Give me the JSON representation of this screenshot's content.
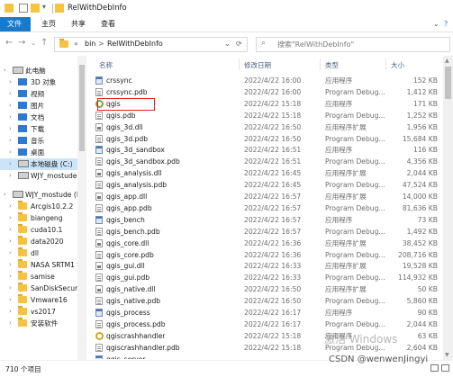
{
  "window": {
    "title": "RelWithDebInfo"
  },
  "ribbon": {
    "tabs": [
      "文件",
      "主页",
      "共享",
      "查看"
    ]
  },
  "address": {
    "breadcrumb": [
      "«",
      "bin",
      ">",
      "RelWithDebInfo"
    ]
  },
  "search": {
    "placeholder": "搜索\"RelWithDebInfo\""
  },
  "nav_pane": {
    "items": [
      {
        "label": "此电脑",
        "icon": "pc-icon",
        "indent": 0
      },
      {
        "label": "3D 对象",
        "icon": "3d-objects-icon",
        "indent": 1
      },
      {
        "label": "视频",
        "icon": "video-icon",
        "indent": 1
      },
      {
        "label": "图片",
        "icon": "pictures-icon",
        "indent": 1
      },
      {
        "label": "文档",
        "icon": "documents-icon",
        "indent": 1
      },
      {
        "label": "下载",
        "icon": "downloads-icon",
        "indent": 1
      },
      {
        "label": "音乐",
        "icon": "music-icon",
        "indent": 1
      },
      {
        "label": "桌面",
        "icon": "desktop-icon",
        "indent": 1
      },
      {
        "label": "本地磁盘 (C:)",
        "icon": "drive-icon",
        "indent": 1,
        "selected": true
      },
      {
        "label": "WJY_mostude (",
        "icon": "drive-icon",
        "indent": 1
      },
      {
        "label": "WJY_mostude (E",
        "icon": "drive-icon",
        "indent": 0
      },
      {
        "label": "Arcgis10.2.2",
        "icon": "folder-icon",
        "indent": 1
      },
      {
        "label": "biangeng",
        "icon": "folder-icon",
        "indent": 1
      },
      {
        "label": "cuda10.1",
        "icon": "folder-icon",
        "indent": 1
      },
      {
        "label": "data2020",
        "icon": "folder-icon",
        "indent": 1
      },
      {
        "label": "dll",
        "icon": "folder-icon",
        "indent": 1
      },
      {
        "label": "NASA SRTM1 v",
        "icon": "folder-icon",
        "indent": 1
      },
      {
        "label": "samise",
        "icon": "folder-icon",
        "indent": 1
      },
      {
        "label": "SanDiskSecure",
        "icon": "folder-icon",
        "indent": 1
      },
      {
        "label": "Vmware16",
        "icon": "folder-icon",
        "indent": 1
      },
      {
        "label": "vs2017",
        "icon": "folder-icon",
        "indent": 1
      },
      {
        "label": "安装软件",
        "icon": "folder-icon",
        "indent": 1
      }
    ]
  },
  "columns": {
    "name": "名称",
    "date": "修改日期",
    "type": "类型",
    "size": "大小"
  },
  "files": [
    {
      "name": "crssync",
      "date": "2022/4/22 16:00",
      "type": "应用程序",
      "size": "152 KB",
      "icon": "exe"
    },
    {
      "name": "crssync.pdb",
      "date": "2022/4/22 16:00",
      "type": "Program Debug...",
      "size": "1,412 KB",
      "icon": "pdb"
    },
    {
      "name": "qgis",
      "date": "2022/4/22 15:18",
      "type": "应用程序",
      "size": "171 KB",
      "icon": "q"
    },
    {
      "name": "qgis.pdb",
      "date": "2022/4/22 15:18",
      "type": "Program Debug...",
      "size": "1,252 KB",
      "icon": "pdb"
    },
    {
      "name": "qgis_3d.dll",
      "date": "2022/4/22 16:50",
      "type": "应用程序扩展",
      "size": "1,956 KB",
      "icon": "dll"
    },
    {
      "name": "qgis_3d.pdb",
      "date": "2022/4/22 16:50",
      "type": "Program Debug...",
      "size": "15,684 KB",
      "icon": "pdb"
    },
    {
      "name": "qgis_3d_sandbox",
      "date": "2022/4/22 16:51",
      "type": "应用程序",
      "size": "116 KB",
      "icon": "exe"
    },
    {
      "name": "qgis_3d_sandbox.pdb",
      "date": "2022/4/22 16:51",
      "type": "Program Debug...",
      "size": "4,356 KB",
      "icon": "pdb"
    },
    {
      "name": "qgis_analysis.dll",
      "date": "2022/4/22 16:45",
      "type": "应用程序扩展",
      "size": "2,044 KB",
      "icon": "dll"
    },
    {
      "name": "qgis_analysis.pdb",
      "date": "2022/4/22 16:45",
      "type": "Program Debug...",
      "size": "47,524 KB",
      "icon": "pdb"
    },
    {
      "name": "qgis_app.dll",
      "date": "2022/4/22 16:57",
      "type": "应用程序扩展",
      "size": "14,000 KB",
      "icon": "dll"
    },
    {
      "name": "qgis_app.pdb",
      "date": "2022/4/22 16:57",
      "type": "Program Debug...",
      "size": "81,636 KB",
      "icon": "pdb"
    },
    {
      "name": "qgis_bench",
      "date": "2022/4/22 16:57",
      "type": "应用程序",
      "size": "73 KB",
      "icon": "exe"
    },
    {
      "name": "qgis_bench.pdb",
      "date": "2022/4/22 16:57",
      "type": "Program Debug...",
      "size": "1,492 KB",
      "icon": "pdb"
    },
    {
      "name": "qgis_core.dll",
      "date": "2022/4/22 16:36",
      "type": "应用程序扩展",
      "size": "38,452 KB",
      "icon": "dll"
    },
    {
      "name": "qgis_core.pdb",
      "date": "2022/4/22 16:36",
      "type": "Program Debug...",
      "size": "208,716 KB",
      "icon": "pdb"
    },
    {
      "name": "qgis_gui.dll",
      "date": "2022/4/22 16:33",
      "type": "应用程序扩展",
      "size": "19,528 KB",
      "icon": "dll"
    },
    {
      "name": "qgis_gui.pdb",
      "date": "2022/4/22 16:33",
      "type": "Program Debug...",
      "size": "114,932 KB",
      "icon": "pdb"
    },
    {
      "name": "qgis_native.dll",
      "date": "2022/4/22 16:50",
      "type": "应用程序扩展",
      "size": "50 KB",
      "icon": "dll"
    },
    {
      "name": "qgis_native.pdb",
      "date": "2022/4/22 16:50",
      "type": "Program Debug...",
      "size": "5,860 KB",
      "icon": "pdb"
    },
    {
      "name": "qgis_process",
      "date": "2022/4/22 16:17",
      "type": "应用程序",
      "size": "90 KB",
      "icon": "exe"
    },
    {
      "name": "qgis_process.pdb",
      "date": "2022/4/22 16:17",
      "type": "Program Debug...",
      "size": "2,044 KB",
      "icon": "pdb"
    },
    {
      "name": "qgiscrashhandler",
      "date": "2022/4/22 15:18",
      "type": "应用程序",
      "size": "63 KB",
      "icon": "qc"
    },
    {
      "name": "qgiscrashhandler.pdb",
      "date": "2022/4/22 15:18",
      "type": "Program Debug...",
      "size": "2,604 KB",
      "icon": "pdb"
    }
  ],
  "partial_row": {
    "name": "qgis_server_..."
  },
  "status": {
    "text": "710 个项目"
  },
  "watermarks": {
    "windows": "激活 Windows",
    "csdn": "CSDN @wenwenJingyi"
  },
  "colors": {
    "accent": "#1979ca",
    "selection": "#cce4f7",
    "highlight_box": "#e02020"
  }
}
